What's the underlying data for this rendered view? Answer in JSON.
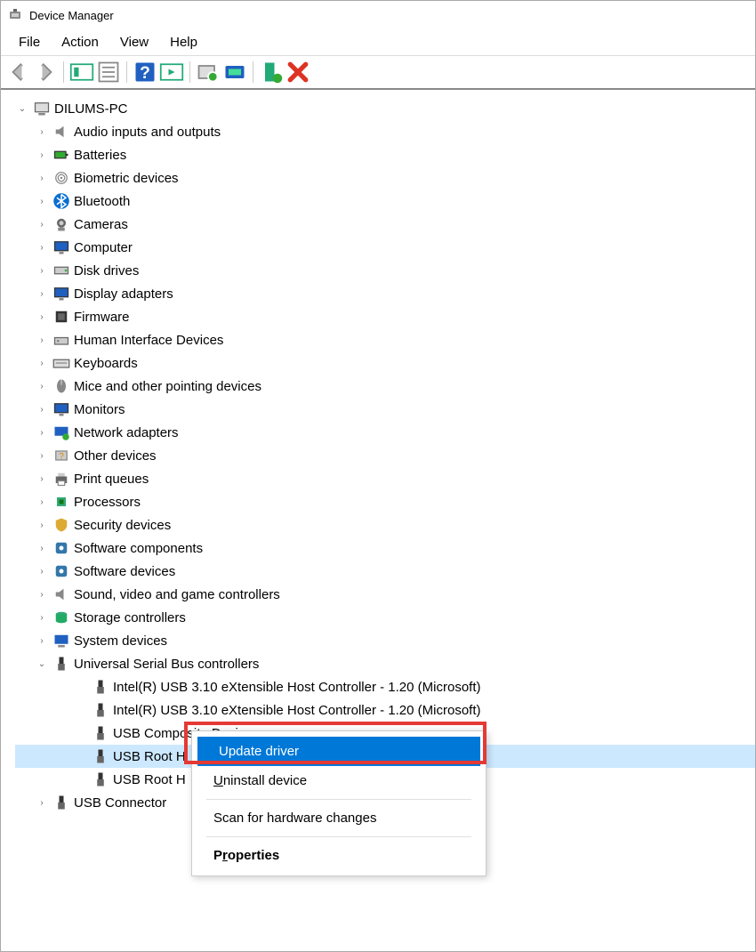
{
  "title": "Device Manager",
  "menubar": [
    "File",
    "Action",
    "View",
    "Help"
  ],
  "root": {
    "name": "DILUMS-PC",
    "expanded": true
  },
  "categories": [
    {
      "label": "Audio inputs and outputs",
      "icon": "speaker"
    },
    {
      "label": "Batteries",
      "icon": "battery"
    },
    {
      "label": "Biometric devices",
      "icon": "fingerprint"
    },
    {
      "label": "Bluetooth",
      "icon": "bluetooth"
    },
    {
      "label": "Cameras",
      "icon": "camera"
    },
    {
      "label": "Computer",
      "icon": "monitor"
    },
    {
      "label": "Disk drives",
      "icon": "drive"
    },
    {
      "label": "Display adapters",
      "icon": "monitor"
    },
    {
      "label": "Firmware",
      "icon": "chip"
    },
    {
      "label": "Human Interface Devices",
      "icon": "hid"
    },
    {
      "label": "Keyboards",
      "icon": "keyboard"
    },
    {
      "label": "Mice and other pointing devices",
      "icon": "mouse"
    },
    {
      "label": "Monitors",
      "icon": "monitor"
    },
    {
      "label": "Network adapters",
      "icon": "network"
    },
    {
      "label": "Other devices",
      "icon": "other"
    },
    {
      "label": "Print queues",
      "icon": "printer"
    },
    {
      "label": "Processors",
      "icon": "cpu"
    },
    {
      "label": "Security devices",
      "icon": "security"
    },
    {
      "label": "Software components",
      "icon": "software"
    },
    {
      "label": "Software devices",
      "icon": "software"
    },
    {
      "label": "Sound, video and game controllers",
      "icon": "speaker"
    },
    {
      "label": "Storage controllers",
      "icon": "storage"
    },
    {
      "label": "System devices",
      "icon": "system"
    },
    {
      "label": "Universal Serial Bus controllers",
      "icon": "usb",
      "expanded": true
    }
  ],
  "usb_children": [
    {
      "label": "Intel(R) USB 3.10 eXtensible Host Controller - 1.20 (Microsoft)"
    },
    {
      "label": "Intel(R) USB 3.10 eXtensible Host Controller - 1.20 (Microsoft)"
    },
    {
      "label": "USB Composite Device"
    },
    {
      "label": "USB Root H",
      "selected": true
    },
    {
      "label": "USB Root H"
    }
  ],
  "usb_connector": {
    "label": "USB Connector"
  },
  "context_menu": {
    "items": [
      {
        "label": "Update driver",
        "highlighted": true
      },
      {
        "label": "Uninstall device",
        "underline_idx": 0
      },
      {
        "separator": true
      },
      {
        "label": "Scan for hardware changes"
      },
      {
        "separator": true
      },
      {
        "label": "Properties",
        "bold": true,
        "underline_idx": 1
      }
    ]
  }
}
